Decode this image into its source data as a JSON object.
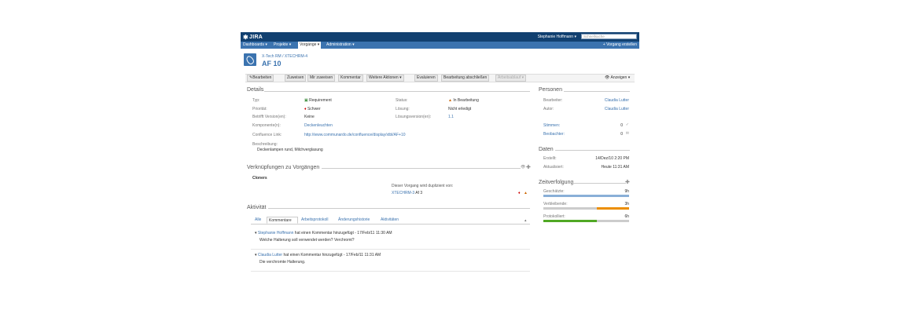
{
  "header": {
    "logo": "JIRA",
    "user": "Stephanie Hoffmann",
    "search_placeholder": "Schnellsuche",
    "nav": [
      "Dashboards",
      "Projekte",
      "Vorgänge",
      "Administration"
    ],
    "create": "+ Vorgang erstellen"
  },
  "issue": {
    "breadcrumb": "X-Tech RM / XTECHRM-4",
    "key": "AF 10"
  },
  "toolbar": {
    "edit": "Bearbeiten",
    "assign": "Zuweisen",
    "assign_me": "Mir zuweisen",
    "comment": "Kommentar",
    "more": "Weitere Aktionen",
    "evaluate": "Evaluieren",
    "finish": "Bearbeitung abschließen",
    "workflow": "Arbeitsablauf",
    "view": "Anzeigen"
  },
  "details": {
    "heading": "Details",
    "type_label": "Typ:",
    "type_value": "Requirement",
    "priority_label": "Priorität:",
    "priority_value": "Schwer",
    "versions_label": "Betrifft Version(en):",
    "versions_value": "Keine",
    "components_label": "Komponente(n):",
    "components_value": "Deckenleuchten",
    "confluence_label": "Confluence Link:",
    "confluence_value": "http://www.communardo.de/confluence/display/xtbl/AF+10",
    "description_label": "Beschreibung:",
    "description_value": "Deckenlampen rund, Milchverglasung",
    "status_label": "Status:",
    "status_value": "In Bearbeitung",
    "resolution_label": "Lösung:",
    "resolution_value": "Nicht erledigt",
    "fix_label": "Lösungsversion(en):",
    "fix_value": "1.1"
  },
  "links": {
    "heading": "Verknüpfungen zu Vorgängen",
    "group": "Cloners",
    "text": "Dieser Vorgang wird duplizient von:",
    "target_link": "XTECHRM-3",
    "target_rest": "Af 3"
  },
  "activity": {
    "heading": "Aktivität",
    "tabs": [
      "Alle",
      "Kommentare",
      "Arbeitsprotokoll",
      "Änderungshistorie",
      "Aktivitäten"
    ],
    "comments": [
      {
        "author": "Stephanie Hoffmann",
        "meta": "hat einen Kommentar hinzugefügt - 17/Feb/11 11:30 AM",
        "body": "Welche Halterung soll verwendet werden? Verchromt?"
      },
      {
        "author": "Claudia Lutter",
        "meta": "hat einen Kommentar hinzugefügt - 17/Feb/11 11:31 AM",
        "body": "Die verchromte Halterung."
      }
    ]
  },
  "people": {
    "heading": "Personen",
    "assignee_label": "Bearbeiter:",
    "assignee_value": "Claudia Lutter",
    "reporter_label": "Autor:",
    "reporter_value": "Claudia Lutter",
    "votes_label": "Stimmen:",
    "votes_value": "0",
    "watchers_label": "Beobachter:",
    "watchers_value": "0"
  },
  "dates": {
    "heading": "Daten",
    "created_label": "Erstellt:",
    "created_value": "14/Dez/10 2:20 PM",
    "updated_label": "Aktualisiert:",
    "updated_value": "Heute 11:31 AM"
  },
  "time": {
    "heading": "Zeitverfolgung",
    "estimated_label": "Geschätzte:",
    "estimated_value": "9h",
    "estimated_fraction": 1.0,
    "remaining_label": "Verbleibende:",
    "remaining_value": "3h",
    "remaining_fraction": 0.375,
    "logged_label": "Protokolliert:",
    "logged_value": "6h",
    "logged_fraction": 0.625,
    "colors": {
      "estimated": "#89afd7",
      "remaining": "#ec8e00",
      "logged": "#51a825",
      "empty": "#cccccc"
    }
  }
}
